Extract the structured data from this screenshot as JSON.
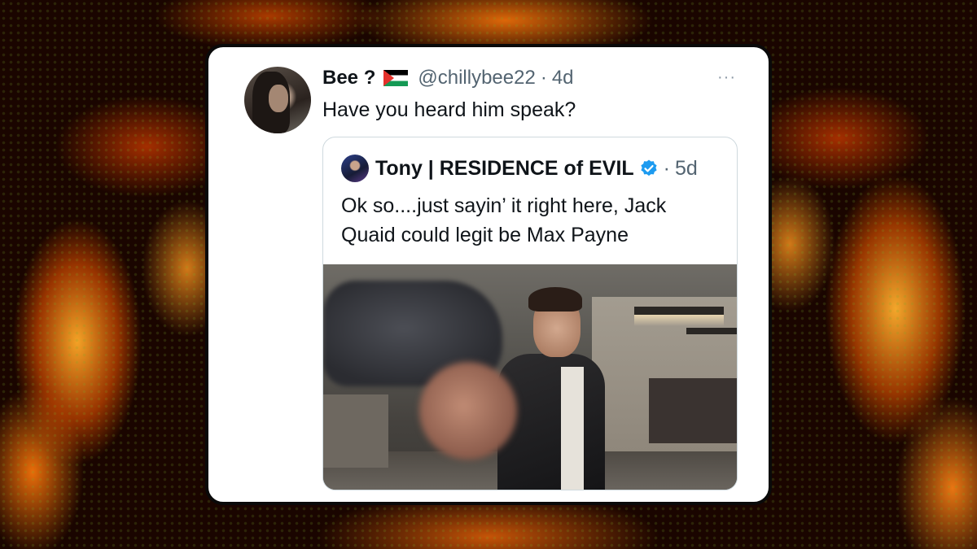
{
  "tweet": {
    "author_name": "Bee ?",
    "flag_icon": "palestine-flag-icon",
    "handle": "@chillybee22",
    "separator": "·",
    "age": "4d",
    "more_icon": "···",
    "text": "Have you heard him speak?"
  },
  "quoted_tweet": {
    "author_name": "Tony | RESIDENCE of EVIL",
    "verified_icon": "verified-badge-icon",
    "verified_color": "#1d9bf0",
    "separator": "·",
    "age": "5d",
    "text_lines": [
      "Ok so....just sayin’ it right here, Jack",
      "Quaid could legit be Max Payne"
    ]
  },
  "colors": {
    "card_bg": "#ffffff",
    "text_primary": "#0f1419",
    "text_secondary": "#536471",
    "border": "#cfd9de"
  }
}
